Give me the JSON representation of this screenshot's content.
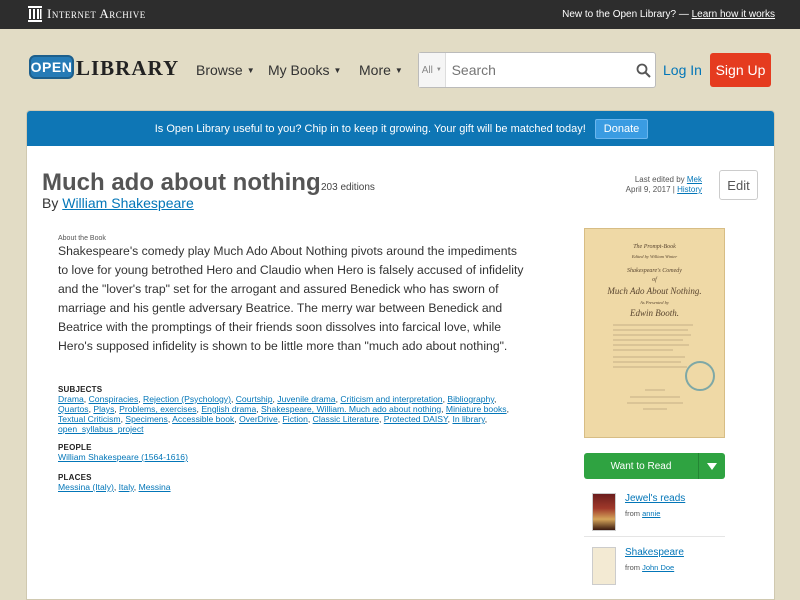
{
  "ia_bar": {
    "logo_text": "Internet Archive",
    "prompt": "New to the Open Library?",
    "dash": "—",
    "learn_link": "Learn how it works"
  },
  "header": {
    "logo_open": "OPEN",
    "logo_library": "LIBRARY",
    "nav": [
      {
        "label": "Browse"
      },
      {
        "label": "My Books"
      },
      {
        "label": "More"
      }
    ],
    "search": {
      "scope": "All",
      "placeholder": "Search"
    },
    "login": "Log In",
    "signup": "Sign Up"
  },
  "banner": {
    "text": "Is Open Library useful to you? Chip in to keep it growing. Your gift will be matched today!",
    "donate": "Donate"
  },
  "book": {
    "title": "Much ado about nothing",
    "editions": "203 editions",
    "by": "By",
    "author": "William Shakespeare",
    "last_edited_label": "Last edited by",
    "last_edited_user": "Mek",
    "last_edited_date": "April 9, 2017 |",
    "history": "History",
    "edit": "Edit",
    "about_label": "About the Book",
    "about": "Shakespeare's comedy play Much Ado About Nothing pivots around the impediments to love for young betrothed Hero and Claudio when Hero is falsely accused of infidelity and the \"lover's trap\" set for the arrogant and assured Benedick who has sworn of marriage and his gentle adversary Beatrice. The merry war between Benedick and Beatrice with the promptings of their friends soon dissolves into farcical love, while Hero's supposed infidelity is shown to be little more than \"much ado about nothing\"."
  },
  "subjects": {
    "heading": "SUBJECTS",
    "items": [
      "Drama",
      "Conspiracies",
      "Rejection (Psychology)",
      "Courtship",
      "Juvenile drama",
      "Criticism and interpretation",
      "Bibliography",
      "Quartos",
      "Plays",
      "Problems, exercises",
      "English drama",
      "Shakespeare, William. Much ado about nothing",
      "Miniature books",
      "Textual Criticism",
      "Specimens",
      "Accessible book",
      "OverDrive",
      "Fiction",
      "Classic Literature",
      "Protected DAISY",
      "In library",
      "open_syllabus_project"
    ]
  },
  "people": {
    "heading": "PEOPLE",
    "items": [
      "William Shakespeare (1564-1616)"
    ]
  },
  "places": {
    "heading": "PLACES",
    "items": [
      "Messina (Italy)",
      "Italy",
      "Messina"
    ]
  },
  "cover": {
    "line1": "The Prompt-Book",
    "line2": "Edited by William Winter",
    "line3": "Shakespeare's Comedy",
    "line4": "of",
    "line5": "Much Ado About Nothing.",
    "line6": "As Presented by",
    "line7": "Edwin Booth."
  },
  "want_to_read": "Want to Read",
  "lists": [
    {
      "title": "Jewel's reads",
      "from": "from",
      "user": "annie"
    },
    {
      "title": "Shakespeare",
      "from": "from",
      "user": "John Doe"
    }
  ],
  "colors": {
    "ia_bar": "#2d2d2d",
    "banner": "#0e76b5",
    "signup": "#e53b1f",
    "want_to_read": "#2fa341",
    "link": "#0376b8"
  }
}
